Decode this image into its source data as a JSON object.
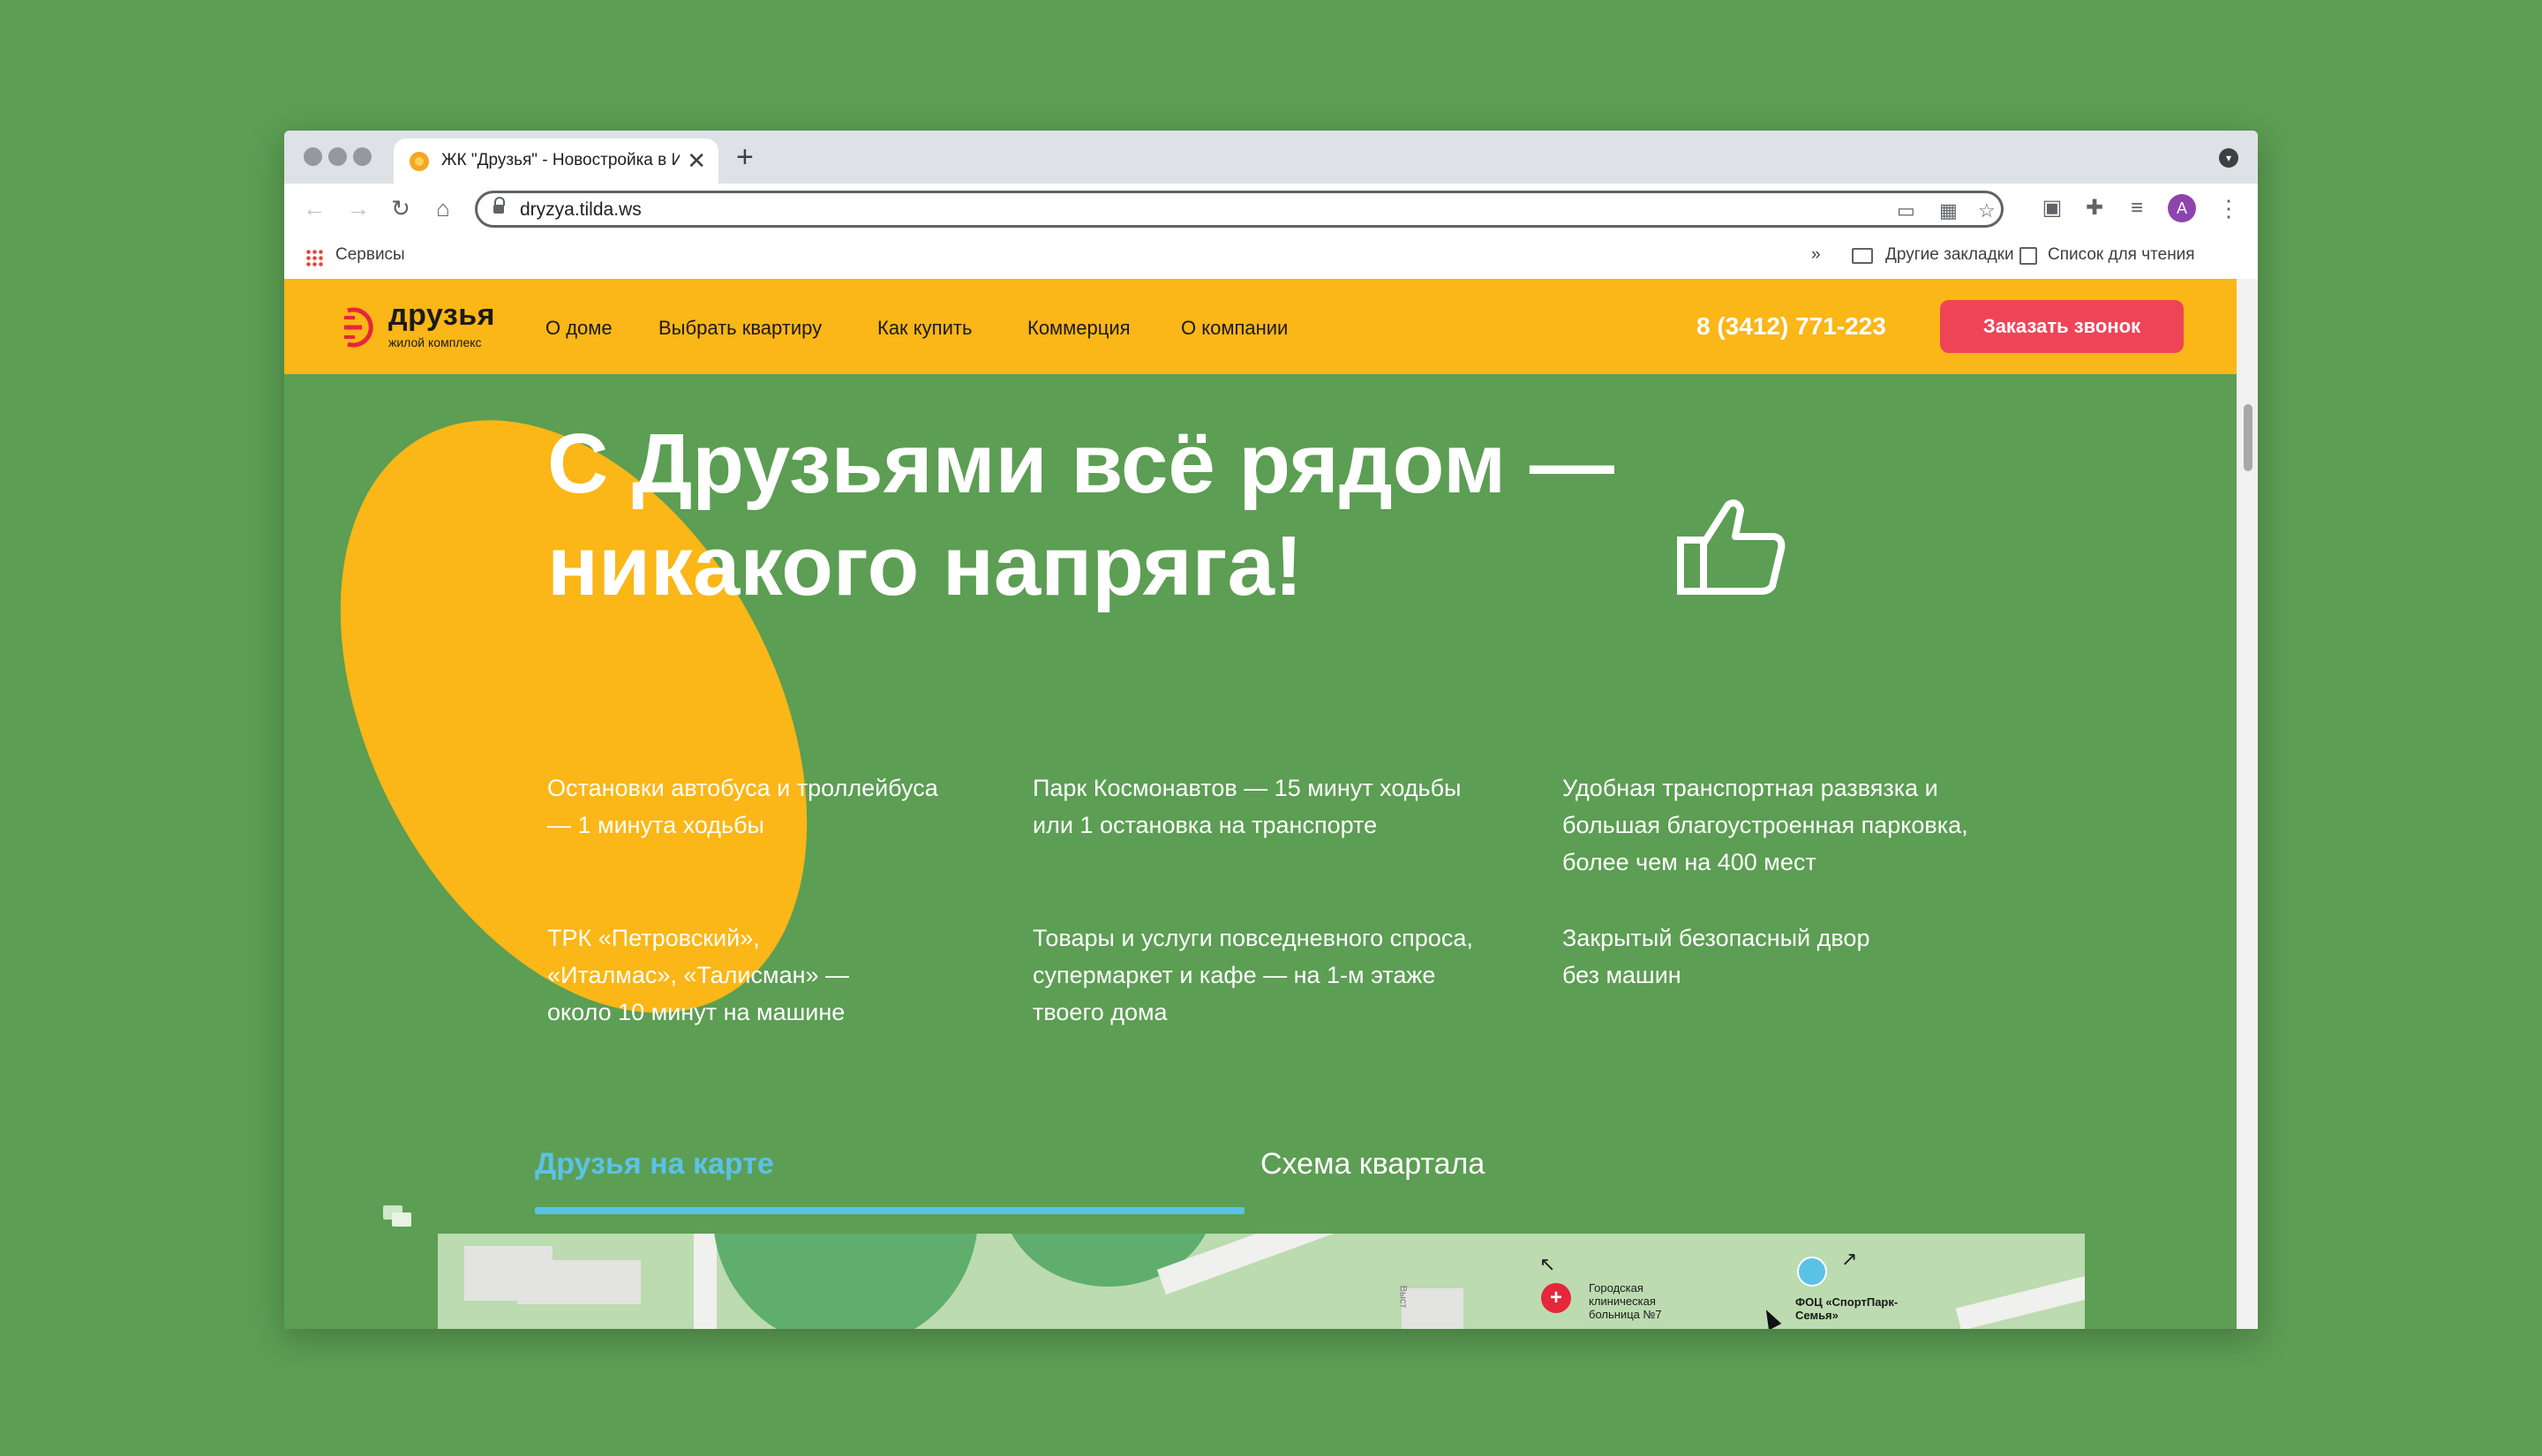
{
  "browser": {
    "tab_title": "ЖК \"Друзья\" - Новостройка в Ижевске",
    "url": "dryzya.tilda.ws",
    "avatar_letter": "A",
    "bookmarks": {
      "apps_label": "Сервисы",
      "more": "»",
      "other_bookmarks": "Другие закладки",
      "reading_list": "Список для чтения"
    }
  },
  "site": {
    "logo": {
      "name": "друзья",
      "subtitle": "жилой комплекс"
    },
    "nav": [
      "О доме",
      "Выбрать квартиру",
      "Как купить",
      "Коммерция",
      "О компании"
    ],
    "phone": "8 (3412) 771-223",
    "cta_label": "Заказать звонок",
    "colors": {
      "accent": "#fbb617",
      "background": "#5c9e53",
      "cta": "#ef4458",
      "active_tab": "#5bc2e7"
    }
  },
  "hero": {
    "headline_line1": "С Друзьями всё рядом —",
    "headline_line2": "никакого напряга!",
    "features": [
      {
        "line1": "Остановки автобуса и троллейбуса",
        "line2": "— 1 минута ходьбы",
        "line3": ""
      },
      {
        "line1": "Парк Космонавтов — 15 минут ходьбы",
        "line2": "или 1 остановка на транспорте",
        "line3": ""
      },
      {
        "line1": "Удобная транспортная развязка и",
        "line2": "большая благоустроенная парковка,",
        "line3": "более чем на 400 мест"
      },
      {
        "line1": "ТРК «Петровский»,",
        "line2": "«Италмас», «Талисман» —",
        "line3": "около 10 минут на машине"
      },
      {
        "line1": "Товары и услуги повседневного спроса,",
        "line2": "супермаркет и кафе — на 1-м этаже",
        "line3": "твоего дома"
      },
      {
        "line1": "Закрытый безопасный двор",
        "line2": "без машин",
        "line3": ""
      }
    ]
  },
  "map_tabs": {
    "active": "Друзья на карте",
    "inactive": "Схема квартала"
  },
  "map": {
    "hospital": [
      "Городская",
      "клиническая",
      "больница №7"
    ],
    "sport": [
      "ФОЦ «СпортПарк-",
      "Семья»"
    ],
    "street": "Выст"
  }
}
